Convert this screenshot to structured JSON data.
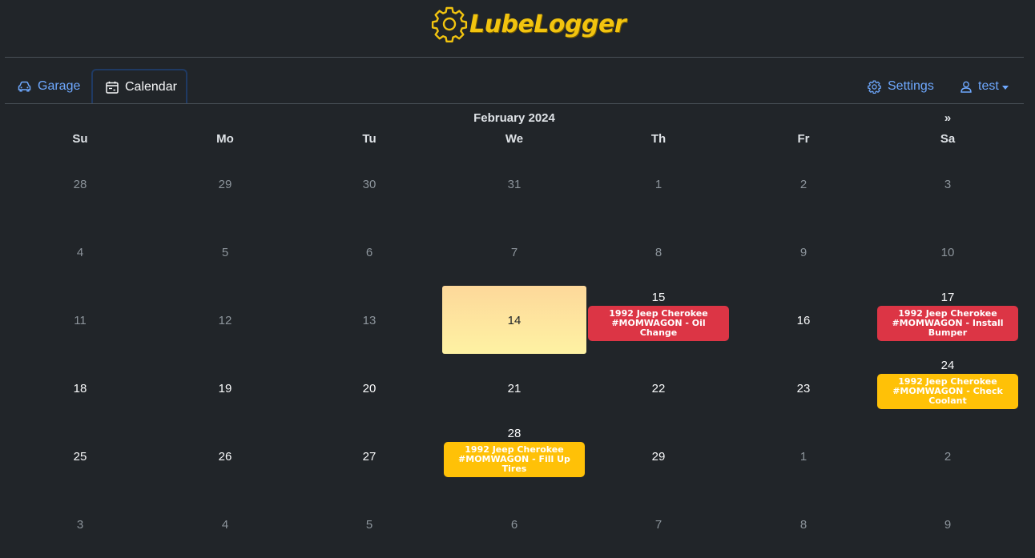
{
  "app": {
    "title": "LubeLogger",
    "brand_color": "#f2c40f"
  },
  "nav": {
    "garage": "Garage",
    "calendar": "Calendar",
    "settings": "Settings",
    "user": "test"
  },
  "calendar": {
    "month_title": "February 2024",
    "next_label": "»",
    "weekdays": [
      "Su",
      "Mo",
      "Tu",
      "We",
      "Th",
      "Fr",
      "Sa"
    ],
    "weeks": [
      [
        {
          "d": "28",
          "m": 1
        },
        {
          "d": "29",
          "m": 1
        },
        {
          "d": "30",
          "m": 1
        },
        {
          "d": "31",
          "m": 1
        },
        {
          "d": "1",
          "m": 1
        },
        {
          "d": "2",
          "m": 1
        },
        {
          "d": "3",
          "m": 1
        }
      ],
      [
        {
          "d": "4",
          "m": 1
        },
        {
          "d": "5",
          "m": 1
        },
        {
          "d": "6",
          "m": 1
        },
        {
          "d": "7",
          "m": 1
        },
        {
          "d": "8",
          "m": 1
        },
        {
          "d": "9",
          "m": 1
        },
        {
          "d": "10",
          "m": 1
        }
      ],
      [
        {
          "d": "11",
          "m": 1
        },
        {
          "d": "12",
          "m": 1
        },
        {
          "d": "13",
          "m": 1
        },
        {
          "d": "14",
          "today": 1
        },
        {
          "d": "15",
          "b": 1,
          "e": "1992 Jeep Cherokee #MOMWAGON - Oil Change",
          "c": "red"
        },
        {
          "d": "16",
          "b": 1
        },
        {
          "d": "17",
          "b": 1,
          "e": "1992 Jeep Cherokee #MOMWAGON - Install Bumper",
          "c": "red"
        }
      ],
      [
        {
          "d": "18",
          "b": 1
        },
        {
          "d": "19",
          "b": 1
        },
        {
          "d": "20",
          "b": 1
        },
        {
          "d": "21",
          "b": 1
        },
        {
          "d": "22",
          "b": 1
        },
        {
          "d": "23",
          "b": 1
        },
        {
          "d": "24",
          "b": 1,
          "e": "1992 Jeep Cherokee #MOMWAGON - Check Coolant",
          "c": "yellow"
        }
      ],
      [
        {
          "d": "25",
          "b": 1
        },
        {
          "d": "26",
          "b": 1
        },
        {
          "d": "27",
          "b": 1
        },
        {
          "d": "28",
          "b": 1,
          "e": "1992 Jeep Cherokee #MOMWAGON - Fill Up Tires",
          "c": "yellow"
        },
        {
          "d": "29",
          "b": 1
        },
        {
          "d": "1",
          "m": 1
        },
        {
          "d": "2",
          "m": 1
        }
      ],
      [
        {
          "d": "3",
          "m": 1
        },
        {
          "d": "4",
          "m": 1
        },
        {
          "d": "5",
          "m": 1
        },
        {
          "d": "6",
          "m": 1
        },
        {
          "d": "7",
          "m": 1
        },
        {
          "d": "8",
          "m": 1
        },
        {
          "d": "9",
          "m": 1
        }
      ]
    ],
    "colors": {
      "red": "#dc3545",
      "yellow": "#ffc107",
      "today_top": "#fdd89a",
      "today_bottom": "#fef2a3"
    }
  }
}
